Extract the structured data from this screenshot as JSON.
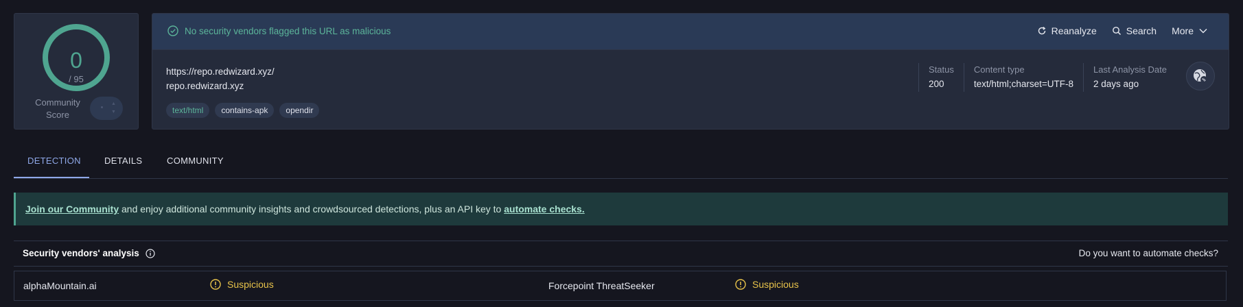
{
  "score": {
    "value": "0",
    "total": "/ 95",
    "community_label": "Community Score"
  },
  "summary": {
    "clean_message": "No security vendors flagged this URL as malicious",
    "actions": {
      "reanalyze": "Reanalyze",
      "search": "Search",
      "more": "More"
    },
    "url": "https://repo.redwizard.xyz/",
    "host": "repo.redwizard.xyz",
    "tags": [
      "text/html",
      "contains-apk",
      "opendir"
    ],
    "status_label": "Status",
    "status_value": "200",
    "content_type_label": "Content type",
    "content_type_value": "text/html;charset=UTF-8",
    "last_analysis_label": "Last Analysis Date",
    "last_analysis_value": "2 days ago"
  },
  "tabs": [
    "DETECTION",
    "DETAILS",
    "COMMUNITY"
  ],
  "banner": {
    "link1": "Join our Community",
    "text": " and enjoy additional community insights and crowdsourced detections, plus an API key to ",
    "link2": "automate checks."
  },
  "vendors": {
    "title": "Security vendors' analysis",
    "automate_prompt": "Do you want to automate checks?",
    "rows": [
      {
        "vendor": "alphaMountain.ai",
        "verdict": "Suspicious",
        "vendor2": "Forcepoint ThreatSeeker",
        "verdict2": "Suspicious"
      }
    ]
  },
  "colors": {
    "accent_green": "#4fa590",
    "suspicious": "#e8c34a",
    "tab_active": "#8fa8e8"
  }
}
